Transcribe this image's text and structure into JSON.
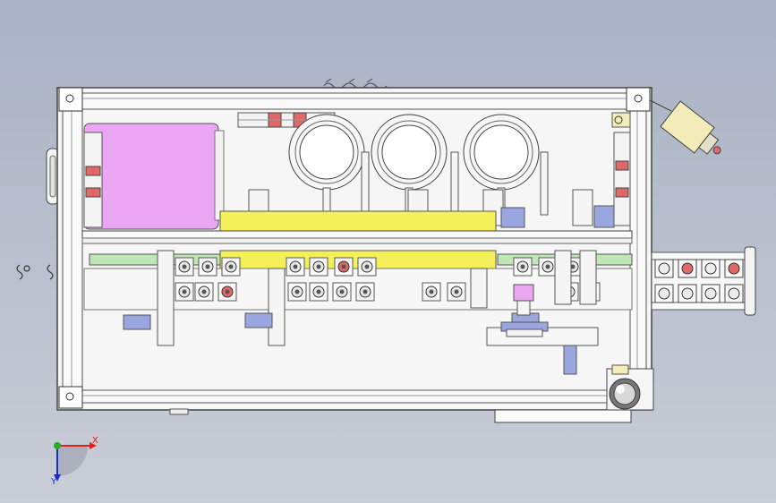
{
  "view": {
    "background_top": "#a9b2c4",
    "background_bottom": "#c9cdd6"
  },
  "triad": {
    "x_label": "X",
    "y_label": "Y",
    "x_color": "#e02020",
    "y_color": "#1a2bd6",
    "z_color": "#22b020"
  },
  "colors": {
    "frame": "#f6f6f6",
    "outline": "#444444",
    "yellow_bar": "#f4f05a",
    "magenta_panel": "#eaa6f2",
    "blue_block": "#9aa6e0",
    "green_rail": "#bfe6b6",
    "red_marker": "#e06868",
    "tan_box": "#f3ecb8"
  },
  "components": {
    "rings": 3,
    "bolts_top_row": 10,
    "bolts_bottom_row": 11,
    "conveyor_rollers": 8
  }
}
